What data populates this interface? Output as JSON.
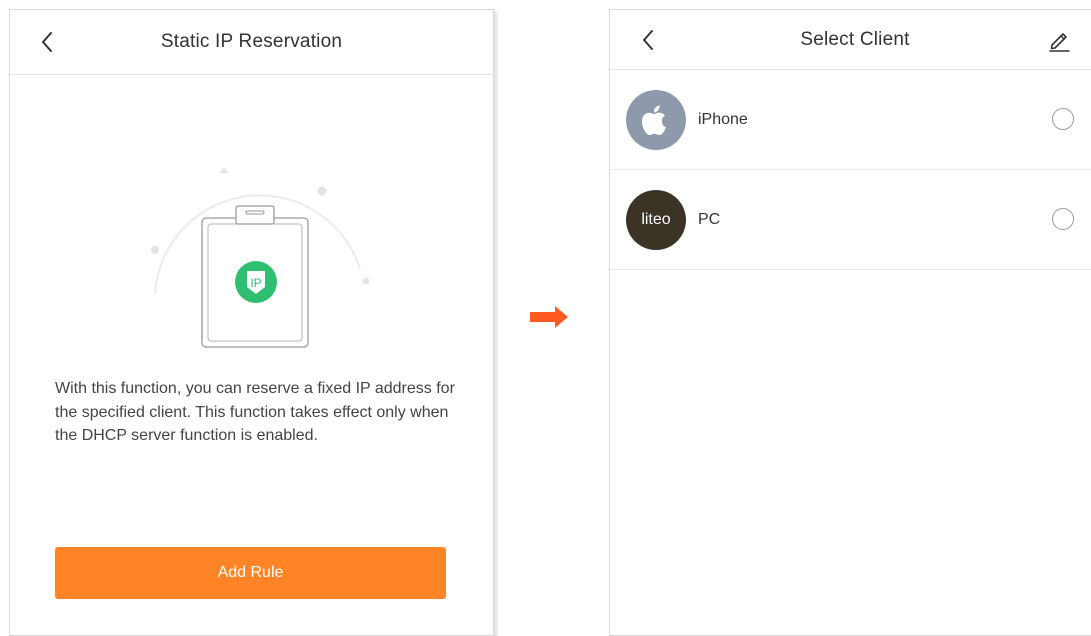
{
  "left_screen": {
    "title": "Static IP Reservation",
    "badge_text": "IP",
    "description": "With this function, you can reserve a fixed IP address for the specified client. This function takes effect only when the DHCP server function is enabled.",
    "add_rule_label": "Add Rule"
  },
  "right_screen": {
    "title": "Select Client",
    "clients": [
      {
        "name": "iPhone",
        "avatar": "apple-icon",
        "avatar_text": "",
        "selected": false
      },
      {
        "name": "PC",
        "avatar": "liteo-logo",
        "avatar_text": "liteo",
        "selected": false
      }
    ]
  },
  "colors": {
    "accent": "#ff8426",
    "ip_badge": "#2fbf71",
    "apple_avatar": "#8e9aab",
    "liteo_avatar": "#3b3426",
    "flow_arrow": "#ff5a1f"
  },
  "icons": {
    "back": "chevron-left-icon",
    "edit": "pencil-icon",
    "flow": "arrow-right-icon"
  }
}
